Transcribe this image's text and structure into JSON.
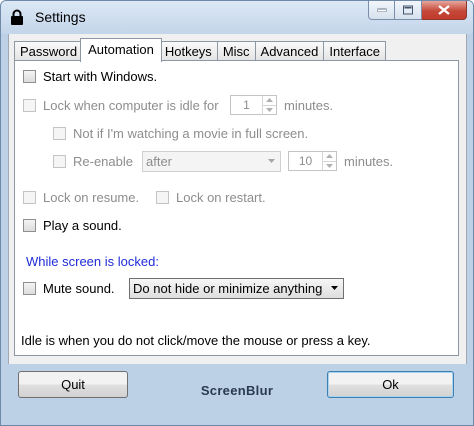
{
  "window": {
    "title": "Settings",
    "icon": "lock-icon",
    "caption_buttons": [
      "minimize-icon",
      "maximize-icon",
      "close-icon"
    ]
  },
  "tabs": [
    {
      "label": "Password",
      "active": false
    },
    {
      "label": "Automation",
      "active": true
    },
    {
      "label": "Hotkeys",
      "active": false
    },
    {
      "label": "Misc",
      "active": false
    },
    {
      "label": "Advanced",
      "active": false
    },
    {
      "label": "Interface",
      "active": false
    }
  ],
  "automation": {
    "start_with_windows": {
      "label": "Start with Windows.",
      "checked": false,
      "enabled": true
    },
    "lock_idle": {
      "label": "Lock when computer is idle for",
      "value": "1",
      "unit": "minutes.",
      "checked": false,
      "enabled": false
    },
    "not_fullscreen": {
      "label": "Not if I'm watching a movie in full screen.",
      "checked": false,
      "enabled": false
    },
    "reenable": {
      "label": "Re-enable",
      "mode": "after",
      "value": "10",
      "unit": "minutes.",
      "checked": false,
      "enabled": false
    },
    "lock_on_resume": {
      "label": "Lock on resume.",
      "checked": false,
      "enabled": false
    },
    "lock_on_restart": {
      "label": "Lock on restart.",
      "checked": false,
      "enabled": false
    },
    "play_sound": {
      "label": "Play a sound.",
      "checked": false,
      "enabled": true
    },
    "while_locked_header": "While screen is locked:",
    "mute_sound": {
      "label": "Mute sound.",
      "checked": false,
      "enabled": true
    },
    "hide_option": "Do not hide or minimize anything",
    "footnote": "Idle is when you do not click/move the mouse or press a key."
  },
  "footer": {
    "quit_label": "Quit",
    "brand": "ScreenBlur",
    "ok_label": "Ok"
  },
  "colors": {
    "accent_text": "#1f2cd8",
    "frame": "#bcd0e6",
    "close_button": "#c5493a"
  }
}
